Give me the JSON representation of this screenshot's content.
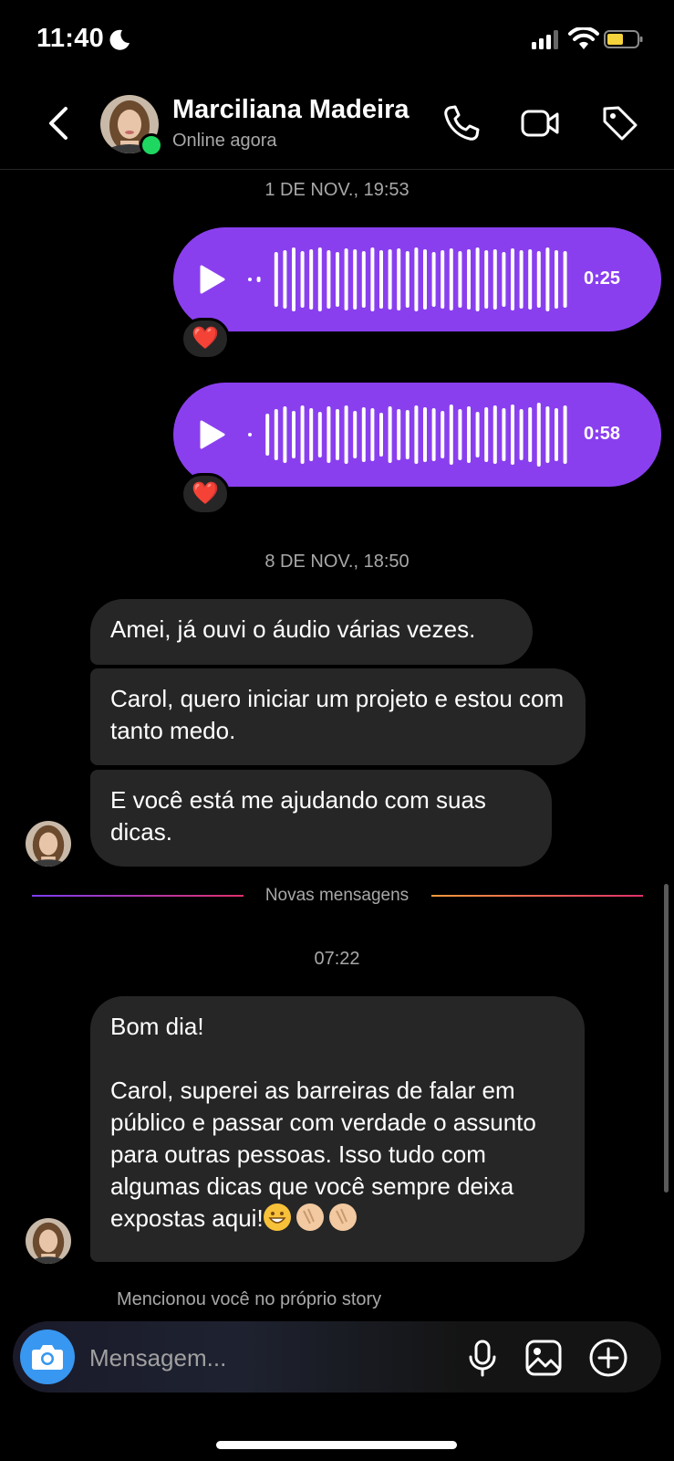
{
  "status_bar": {
    "time": "11:40"
  },
  "header": {
    "contact_name": "Marciliana Madeira",
    "contact_status": "Online agora"
  },
  "conversation": {
    "timestamp_1": "1 DE NOV., 19:53",
    "voice_messages": [
      {
        "duration": "0:25",
        "reaction": "❤️"
      },
      {
        "duration": "0:58",
        "reaction": "❤️"
      }
    ],
    "timestamp_2": "8 DE NOV., 18:50",
    "received_1": "Amei, já ouvi o áudio várias vezes.",
    "received_2": "Carol, quero iniciar um projeto e estou com tanto medo.",
    "received_3": "E você está me ajudando com suas dicas.",
    "new_messages_label": "Novas mensagens",
    "timestamp_3": "07:22",
    "received_4_greeting": "Bom dia!",
    "received_4_body": "Carol, superei as barreiras de falar em público e passar com verdade o assunto para outras pessoas. Isso tudo com algumas dicas que você sempre deixa expostas aqui!",
    "story_mention": "Mencionou você no próprio story"
  },
  "composer": {
    "placeholder": "Mensagem..."
  },
  "colors": {
    "voice_bubble": "#8a3fef",
    "received_bubble": "#262626",
    "online": "#1ed760",
    "camera": "#3897f0"
  }
}
